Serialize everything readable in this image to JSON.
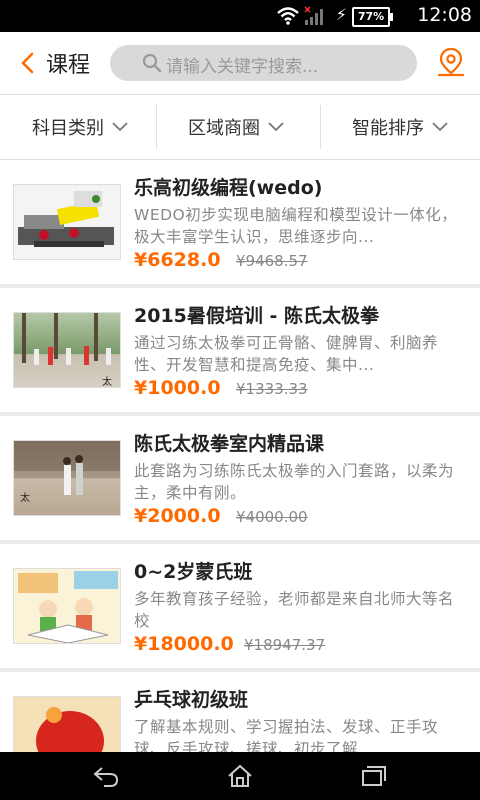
{
  "status_bar": {
    "time": "12:08",
    "battery": "77%"
  },
  "header": {
    "title": "课程",
    "search_placeholder": "请输入关键字搜索..."
  },
  "filters": [
    {
      "label": "科目类别"
    },
    {
      "label": "区域商圈"
    },
    {
      "label": "智能排序"
    }
  ],
  "courses": [
    {
      "name": "乐高初级编程(wedo)",
      "desc": "WEDO初步实现电脑编程和模型设计一体化，极大丰富学生认识，思维逐步向...",
      "price": "¥6628.0",
      "original_price": "¥9468.57"
    },
    {
      "name": "2015暑假培训 - 陈氏太极拳",
      "desc": "通过习练太极拳可正骨骼、健脾胃、利脑养性、开发智慧和提高免疫、集中...",
      "price": "¥1000.0",
      "original_price": "¥1333.33"
    },
    {
      "name": "陈氏太极拳室内精品课",
      "desc": "此套路为习练陈氏太极拳的入门套路，以柔为主，柔中有刚。",
      "price": "¥2000.0",
      "original_price": "¥4000.00"
    },
    {
      "name": "0~2岁蒙氏班",
      "desc": "多年教育孩子经验，老师都是来自北师大等名校",
      "price": "¥18000.0",
      "original_price": "¥18947.37"
    },
    {
      "name": "乒乓球初级班",
      "desc": "了解基本规则、学习握拍法、发球、正手攻球、反手攻球、搓球、初步了解...",
      "price": "",
      "original_price": ""
    }
  ],
  "colors": {
    "accent": "#ff6a00",
    "header_bg": "#ffffff",
    "search_bg": "#d9d9d9"
  }
}
